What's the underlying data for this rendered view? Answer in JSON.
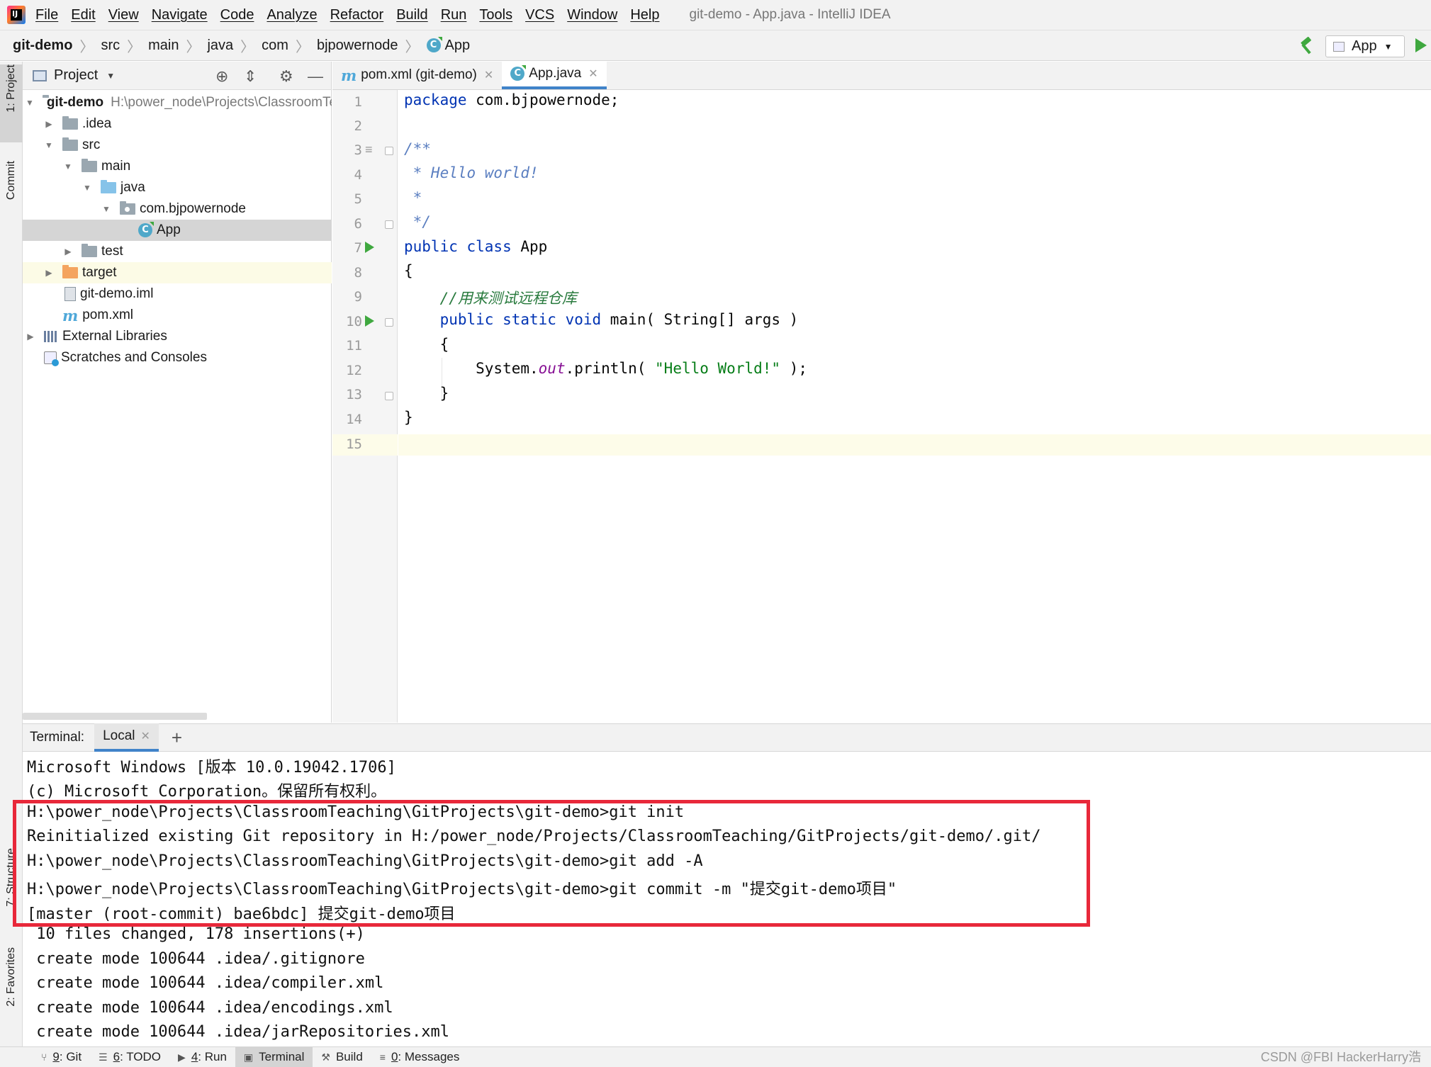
{
  "menu": {
    "items": [
      "File",
      "Edit",
      "View",
      "Navigate",
      "Code",
      "Analyze",
      "Refactor",
      "Build",
      "Run",
      "Tools",
      "VCS",
      "Window",
      "Help"
    ],
    "window_title": "git-demo - App.java - IntelliJ IDEA"
  },
  "breadcrumb": [
    "git-demo",
    "src",
    "main",
    "java",
    "com",
    "bjpowernode",
    "App"
  ],
  "run_config": {
    "label": "App"
  },
  "left_strip": {
    "project": "1: Project",
    "commit": "Commit",
    "structure": "7: Structure",
    "favorites": "2: Favorites"
  },
  "project_panel": {
    "title": "Project",
    "tree": [
      {
        "label": "git-demo",
        "detail": "H:\\power_node\\Projects\\ClassroomTeaching"
      },
      {
        "label": ".idea"
      },
      {
        "label": "src"
      },
      {
        "label": "main"
      },
      {
        "label": "java"
      },
      {
        "label": "com.bjpowernode"
      },
      {
        "label": "App"
      },
      {
        "label": "test"
      },
      {
        "label": "target"
      },
      {
        "label": "git-demo.iml"
      },
      {
        "label": "pom.xml"
      },
      {
        "label": "External Libraries"
      },
      {
        "label": "Scratches and Consoles"
      }
    ]
  },
  "editor": {
    "tabs": [
      {
        "label": "pom.xml (git-demo)"
      },
      {
        "label": "App.java"
      }
    ],
    "line_numbers": [
      "1",
      "2",
      "3",
      "4",
      "5",
      "6",
      "7",
      "8",
      "9",
      "10",
      "11",
      "12",
      "13",
      "14",
      "15"
    ],
    "code": {
      "l1_kw": "package",
      "l1_rest": " com.bjpowernode;",
      "l3": "/**",
      "l4": " * Hello world!",
      "l5": " *",
      "l6": " */",
      "l7_kw": "public class",
      "l7_rest": " App",
      "l8": "{",
      "l9": "    //用来测试远程仓库",
      "l10_kw": "    public static void",
      "l10_rest": " main( String[] args )",
      "l11": "    {",
      "l12_a": "        System.",
      "l12_field": "out",
      "l12_b": ".println( ",
      "l12_str": "\"Hello World!\"",
      "l12_c": " );",
      "l13": "    }",
      "l14": "}"
    }
  },
  "terminal": {
    "label": "Terminal:",
    "tab": "Local",
    "lines": [
      "Microsoft Windows [版本 10.0.19042.1706]",
      "(c) Microsoft Corporation。保留所有权利。",
      "H:\\power_node\\Projects\\ClassroomTeaching\\GitProjects\\git-demo>git init",
      "Reinitialized existing Git repository in H:/power_node/Projects/ClassroomTeaching/GitProjects/git-demo/.git/",
      "H:\\power_node\\Projects\\ClassroomTeaching\\GitProjects\\git-demo>git add -A",
      "H:\\power_node\\Projects\\ClassroomTeaching\\GitProjects\\git-demo>git commit -m \"提交git-demo项目\"",
      "[master (root-commit) bae6bdc] 提交git-demo项目",
      " 10 files changed, 178 insertions(+)",
      " create mode 100644 .idea/.gitignore",
      " create mode 100644 .idea/compiler.xml",
      " create mode 100644 .idea/encodings.xml",
      " create mode 100644 .idea/jarRepositories.xml"
    ]
  },
  "bottom_bar": {
    "tabs": [
      {
        "num": "9",
        "label": ": Git"
      },
      {
        "num": "6",
        "label": ": TODO"
      },
      {
        "num": "4",
        "label": ": Run"
      },
      {
        "num": "",
        "label": "Terminal"
      },
      {
        "num": "",
        "label": "Build"
      },
      {
        "num": "0",
        "label": ": Messages"
      }
    ]
  },
  "watermark": "CSDN @FBI HackerHarry浩",
  "colors": {
    "accent": "#4083c9",
    "highlight_box": "#e8283a",
    "run_green": "#3fa83f"
  }
}
